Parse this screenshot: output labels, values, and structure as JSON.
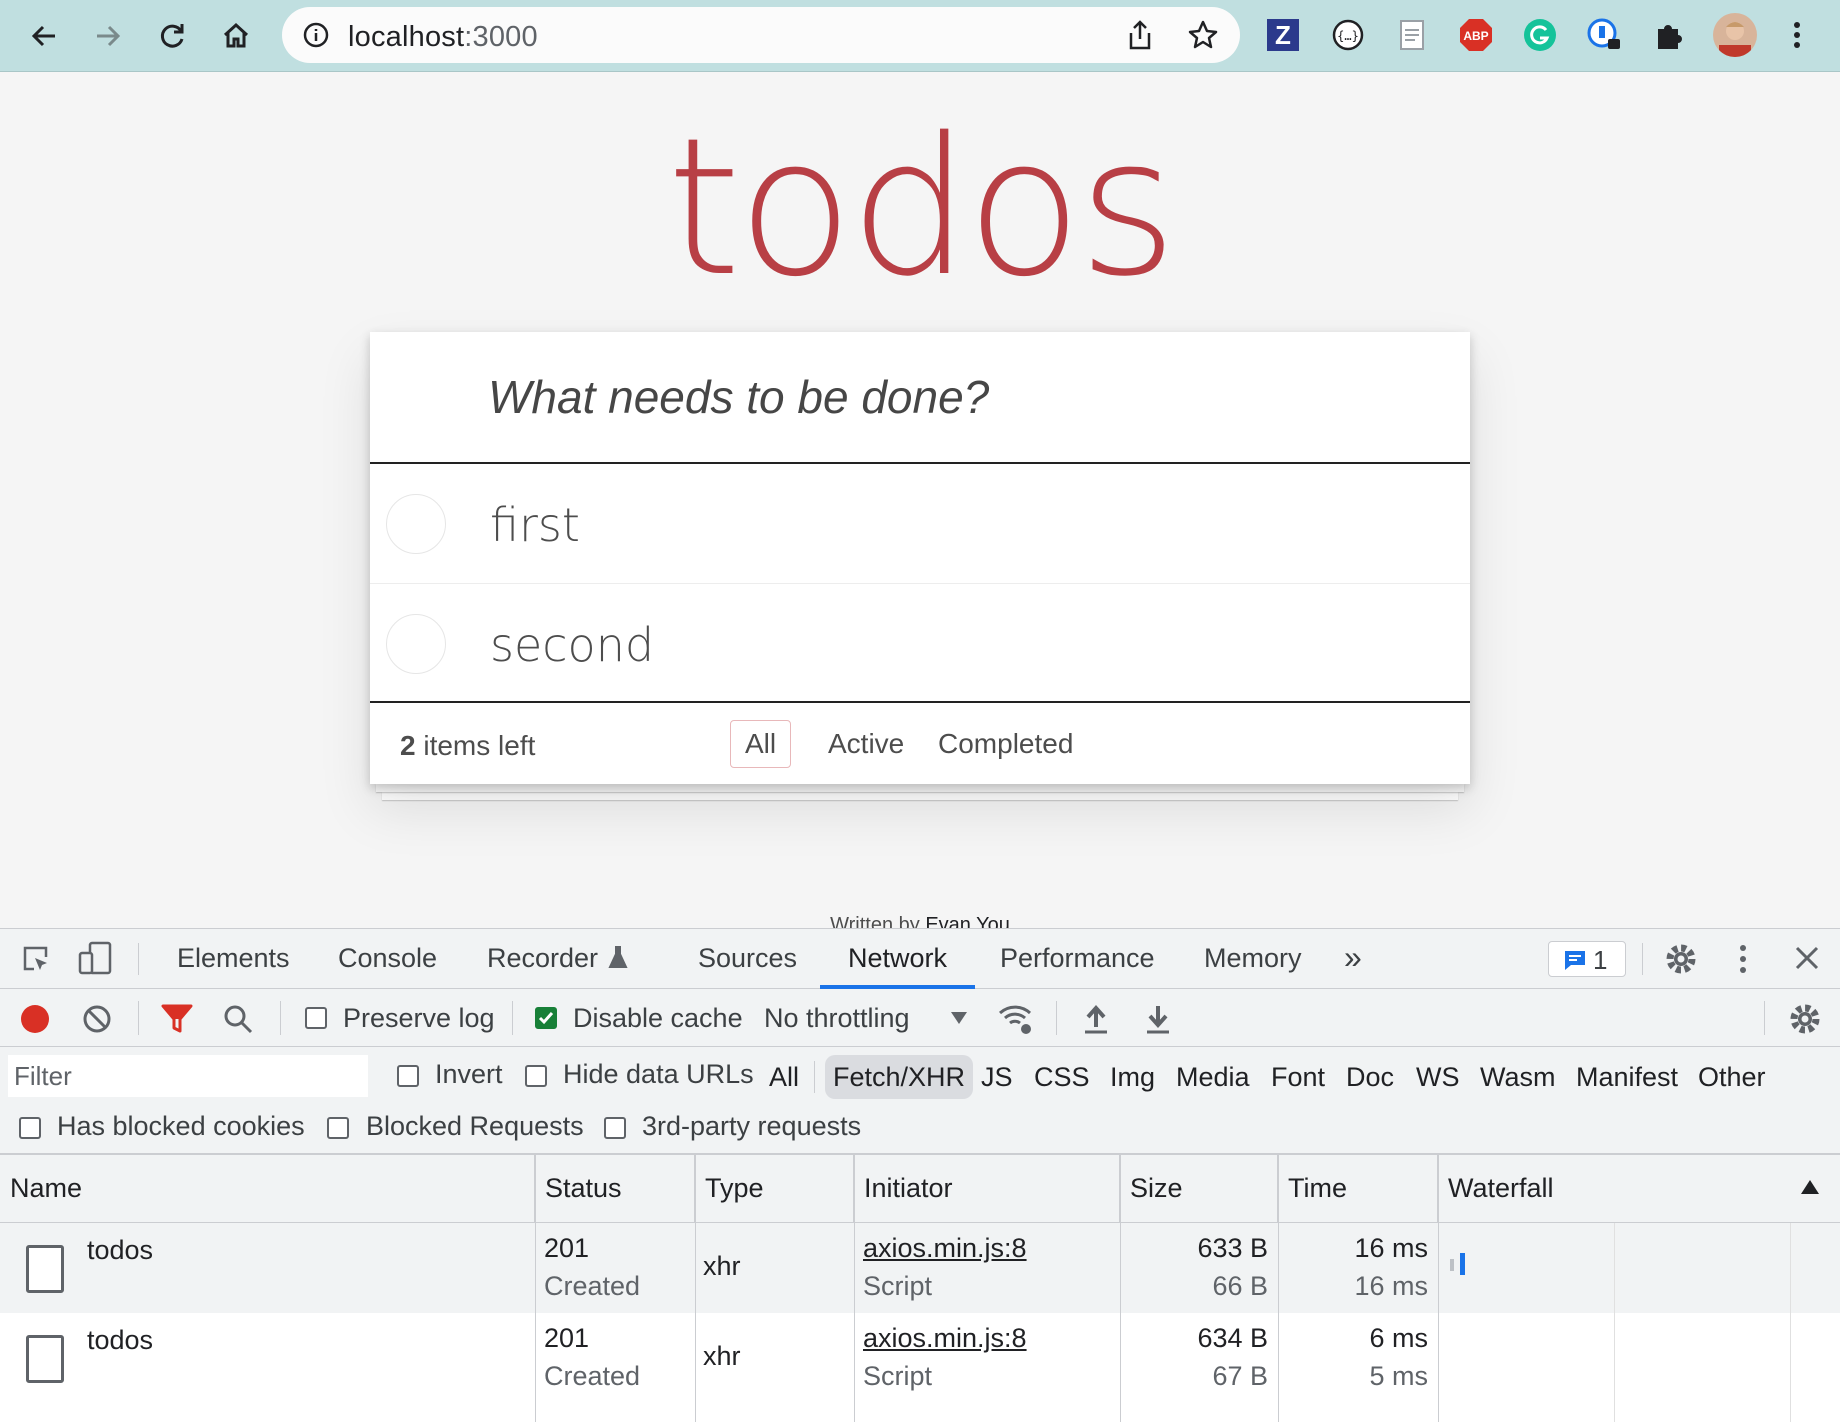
{
  "browser": {
    "url_host": "localhost",
    "url_port": ":3000",
    "extensions": [
      "zotero-icon",
      "json-viewer-icon",
      "notes-icon",
      "adblock-plus-icon",
      "grammarly-icon",
      "password-manager-icon",
      "extensions-puzzle-icon"
    ],
    "abp_label": "ABP",
    "zotero_label": "Z"
  },
  "todo": {
    "title": "todos",
    "new_placeholder": "What needs to be done?",
    "items": [
      {
        "label": "first",
        "completed": false
      },
      {
        "label": "second",
        "completed": false
      }
    ],
    "count_number": "2",
    "count_suffix": " items left",
    "filters": [
      "All",
      "Active",
      "Completed"
    ],
    "selected_filter": "All",
    "info_prefix": "Written by ",
    "info_author": "Evan You"
  },
  "devtools": {
    "tabs": [
      "Elements",
      "Console",
      "Recorder",
      "Sources",
      "Network",
      "Performance",
      "Memory"
    ],
    "active_tab": "Network",
    "more_tabs": "»",
    "message_count": "1",
    "toolbar": {
      "preserve_log": "Preserve log",
      "disable_cache": "Disable cache",
      "disable_cache_checked": true,
      "throttling": "No throttling"
    },
    "filter": {
      "placeholder": "Filter",
      "invert": "Invert",
      "hide_data_urls": "Hide data URLs",
      "types": [
        "All",
        "Fetch/XHR",
        "JS",
        "CSS",
        "Img",
        "Media",
        "Font",
        "Doc",
        "WS",
        "Wasm",
        "Manifest",
        "Other"
      ],
      "active_type": "Fetch/XHR",
      "has_blocked_cookies": "Has blocked cookies",
      "blocked_requests": "Blocked Requests",
      "third_party": "3rd-party requests"
    },
    "table": {
      "columns": [
        "Name",
        "Status",
        "Type",
        "Initiator",
        "Size",
        "Time",
        "Waterfall"
      ],
      "rows": [
        {
          "name": "todos",
          "status": "201",
          "status_text": "Created",
          "type": "xhr",
          "initiator": "axios.min.js:8",
          "initiator_type": "Script",
          "size": "633 B",
          "resource_size": "66 B",
          "time": "16 ms",
          "latency": "16 ms"
        },
        {
          "name": "todos",
          "status": "201",
          "status_text": "Created",
          "type": "xhr",
          "initiator": "axios.min.js:8",
          "initiator_type": "Script",
          "size": "634 B",
          "resource_size": "67 B",
          "time": "6 ms",
          "latency": "5 ms"
        }
      ]
    }
  },
  "colors": {
    "todo_title": "#b83f45",
    "browser_bar": "#c0dfe0",
    "devtools_accent": "#1a73e8",
    "record": "#d93025",
    "filter_icon": "#d93025"
  }
}
